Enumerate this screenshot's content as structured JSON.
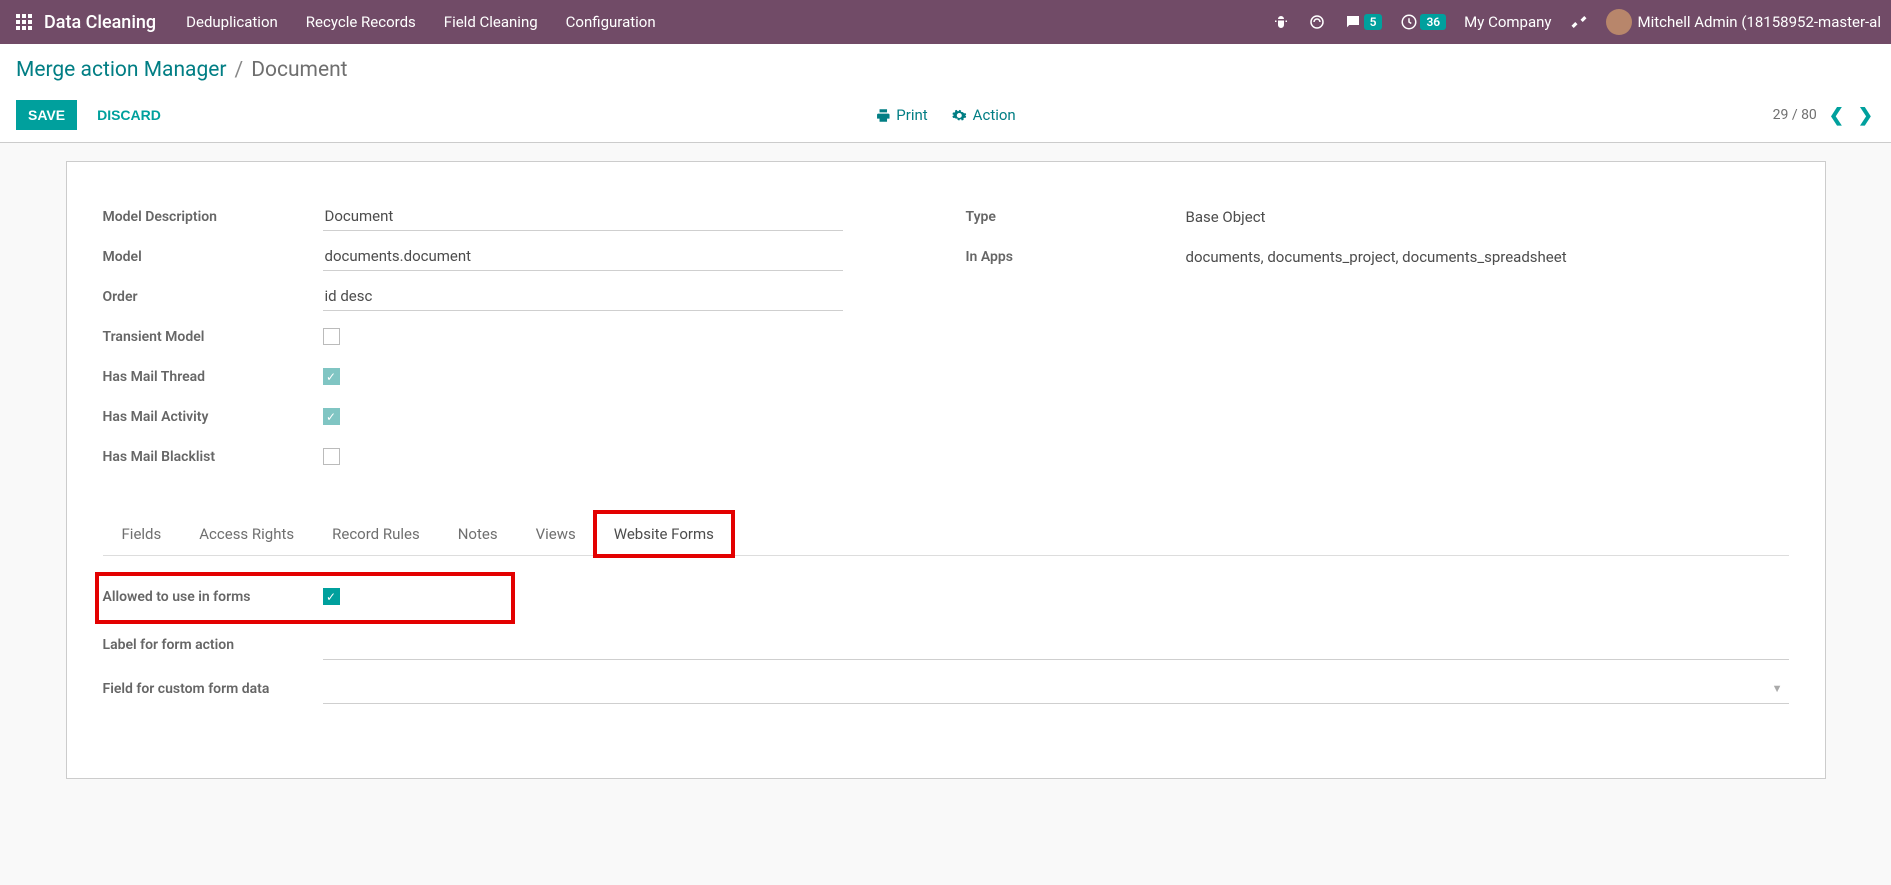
{
  "nav": {
    "brand": "Data Cleaning",
    "items": [
      "Deduplication",
      "Recycle Records",
      "Field Cleaning",
      "Configuration"
    ],
    "badges": {
      "messages": "5",
      "activities": "36"
    },
    "company": "My Company",
    "user": "Mitchell Admin (18158952-master-al"
  },
  "breadcrumb": {
    "parent": "Merge action Manager",
    "current": "Document"
  },
  "buttons": {
    "save": "SAVE",
    "discard": "DISCARD",
    "print": "Print",
    "action": "Action"
  },
  "pager": {
    "text": "29 / 80"
  },
  "form": {
    "model_description_label": "Model Description",
    "model_description_value": "Document",
    "model_label": "Model",
    "model_value": "documents.document",
    "order_label": "Order",
    "order_value": "id desc",
    "transient_label": "Transient Model",
    "has_mail_thread_label": "Has Mail Thread",
    "has_mail_activity_label": "Has Mail Activity",
    "has_mail_blacklist_label": "Has Mail Blacklist",
    "type_label": "Type",
    "type_value": "Base Object",
    "in_apps_label": "In Apps",
    "in_apps_value": "documents, documents_project, documents_spreadsheet"
  },
  "tabs": [
    "Fields",
    "Access Rights",
    "Record Rules",
    "Notes",
    "Views",
    "Website Forms"
  ],
  "website_forms": {
    "allowed_label": "Allowed to use in forms",
    "label_action_label": "Label for form action",
    "custom_field_label": "Field for custom form data"
  }
}
